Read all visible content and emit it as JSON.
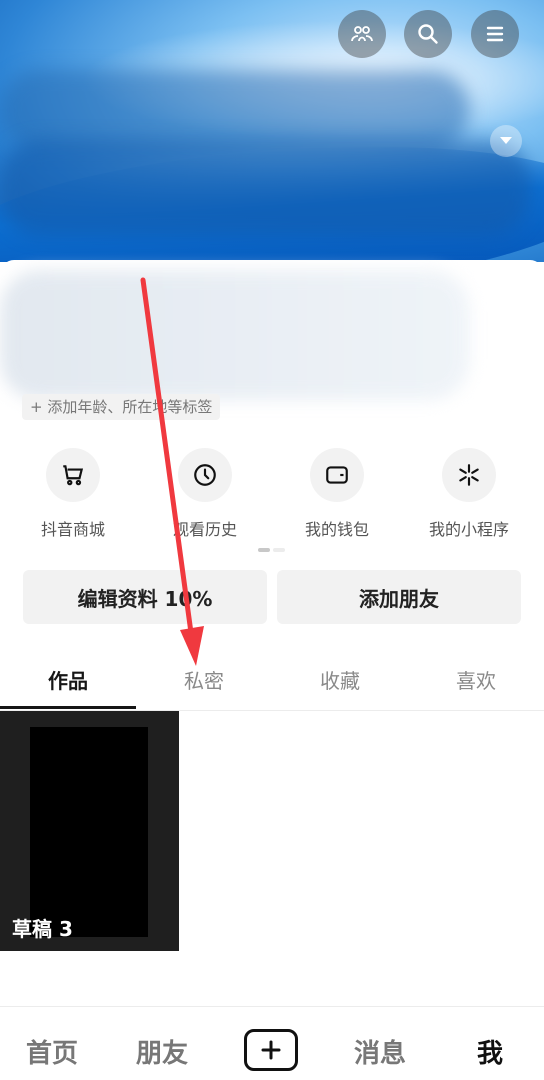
{
  "header": {
    "icons": [
      "friends-icon",
      "search-icon",
      "menu-icon"
    ]
  },
  "profile": {
    "tag_chip": "+ 添加年龄、所在地等标签"
  },
  "quick_actions": [
    {
      "label": "抖音商城",
      "icon": "cart-icon"
    },
    {
      "label": "观看历史",
      "icon": "clock-icon"
    },
    {
      "label": "我的钱包",
      "icon": "wallet-icon"
    },
    {
      "label": "我的小程序",
      "icon": "mini-program-icon"
    }
  ],
  "buttons": {
    "edit_profile": "编辑资料 10%",
    "add_friend": "添加朋友"
  },
  "tabs": [
    {
      "label": "作品",
      "active": true
    },
    {
      "label": "私密",
      "active": false
    },
    {
      "label": "收藏",
      "active": false
    },
    {
      "label": "喜欢",
      "active": false
    }
  ],
  "grid": {
    "draft_label": "草稿 3"
  },
  "bottom_nav": {
    "home": "首页",
    "friends": "朋友",
    "messages": "消息",
    "me": "我"
  },
  "colors": {
    "accent_red": "#f0393f",
    "banner_blue": "#2f86d6"
  }
}
